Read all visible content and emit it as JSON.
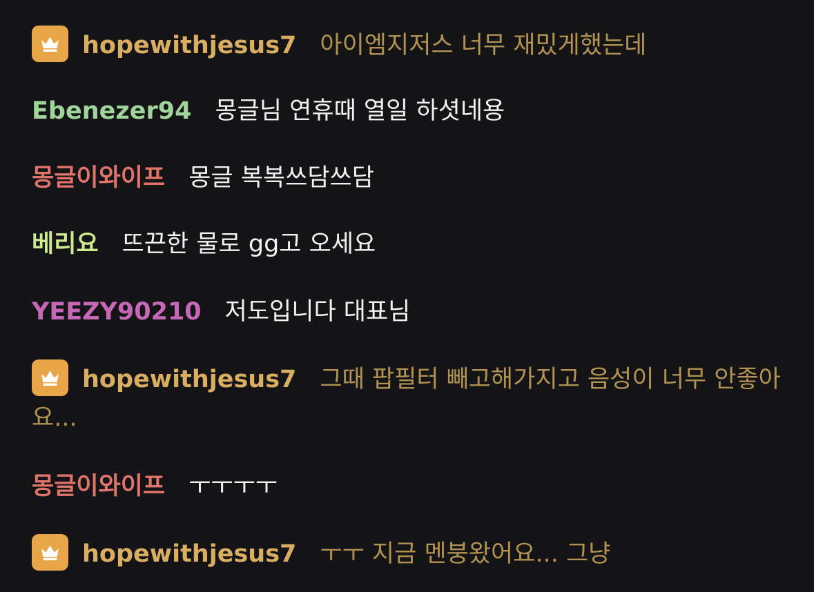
{
  "colors": {
    "background": "#141416",
    "host_badge": "#e9a648",
    "host_name": "#d9ad62",
    "host_text": "#b29252",
    "default_text": "#f2f2f2"
  },
  "messages": [
    {
      "user": "hopewithjesus7",
      "text": "아이엠지저스 너무 재밌게했는데",
      "host": true,
      "badge_icon": "crown-icon",
      "name_color": "#d9ad62",
      "text_color": "#b29252"
    },
    {
      "user": "Ebenezer94",
      "text": "몽글님 연휴때 열일 하셧네용",
      "host": false,
      "name_color": "#9fd49a",
      "text_color": "#f2f2f2"
    },
    {
      "user": "몽글이와이프",
      "text": "몽글 복복쓰담쓰담",
      "host": false,
      "name_color": "#e0736a",
      "text_color": "#f2f2f2"
    },
    {
      "user": "베리요",
      "text": "뜨끈한 물로 gg고 오세요",
      "host": false,
      "name_color": "#cde98f",
      "text_color": "#f2f2f2"
    },
    {
      "user": "YEEZY90210",
      "text": "저도입니다 대표님",
      "host": false,
      "name_color": "#c768b6",
      "text_color": "#f2f2f2"
    },
    {
      "user": "hopewithjesus7",
      "text": "그때 팝필터 빼고해가지고 음성이 너무 안좋아요...",
      "host": true,
      "badge_icon": "crown-icon",
      "name_color": "#d9ad62",
      "text_color": "#b29252"
    },
    {
      "user": "몽글이와이프",
      "text": "ㅜㅜㅜㅜ",
      "host": false,
      "name_color": "#e0736a",
      "text_color": "#f2f2f2"
    },
    {
      "user": "hopewithjesus7",
      "text": "ㅜㅜ 지금 멘붕왔어요... 그냥",
      "host": true,
      "badge_icon": "crown-icon",
      "name_color": "#d9ad62",
      "text_color": "#b29252"
    }
  ]
}
